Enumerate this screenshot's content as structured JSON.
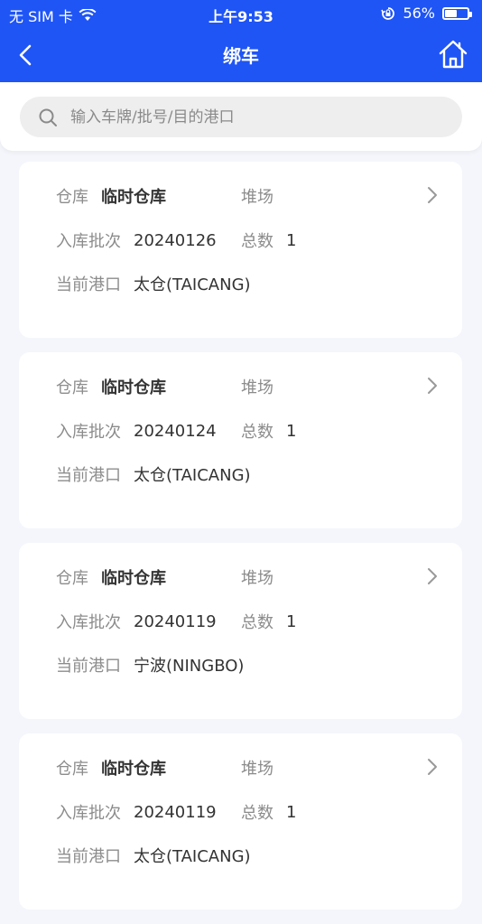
{
  "status_bar": {
    "carrier": "无 SIM 卡",
    "time": "上午9:53",
    "battery_percent": "56%",
    "battery_level": 0.56
  },
  "nav": {
    "title": "绑车"
  },
  "search": {
    "placeholder": "输入车牌/批号/目的港口"
  },
  "labels": {
    "warehouse": "仓库",
    "yard": "堆场",
    "batch": "入库批次",
    "total": "总数",
    "port": "当前港口"
  },
  "cards": [
    {
      "warehouse": "临时仓库",
      "yard": "",
      "batch": "20240126",
      "total": "1",
      "port": "太仓(TAICANG)"
    },
    {
      "warehouse": "临时仓库",
      "yard": "",
      "batch": "20240124",
      "total": "1",
      "port": "太仓(TAICANG)"
    },
    {
      "warehouse": "临时仓库",
      "yard": "",
      "batch": "20240119",
      "total": "1",
      "port": "宁波(NINGBO)"
    },
    {
      "warehouse": "临时仓库",
      "yard": "",
      "batch": "20240119",
      "total": "1",
      "port": "太仓(TAICANG)"
    }
  ],
  "colors": {
    "brand": "#1f55f5",
    "page_bg": "#f4f6fb",
    "label": "#8c8c8c",
    "value": "#333333"
  }
}
